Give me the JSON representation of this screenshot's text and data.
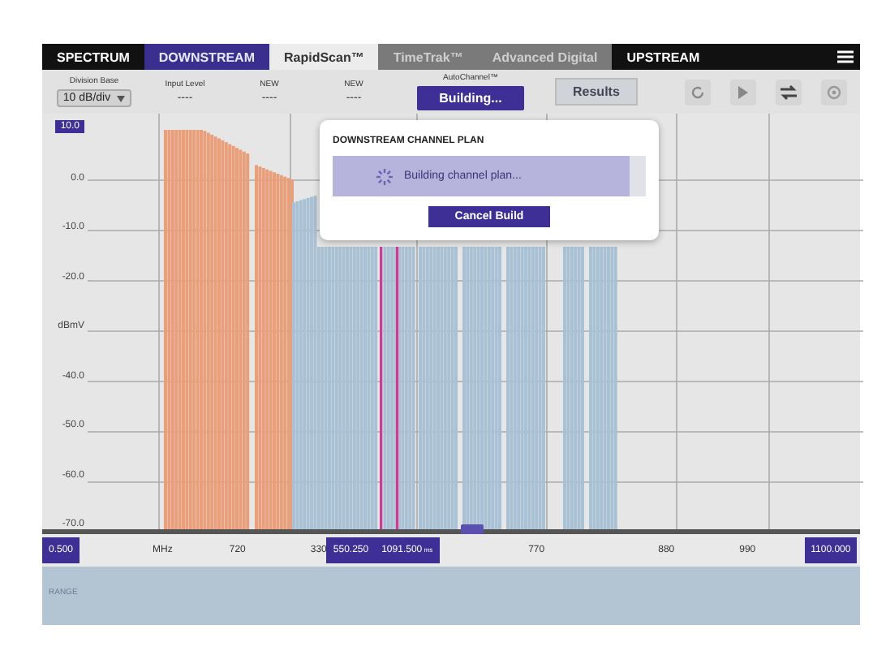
{
  "tabs": [
    {
      "label": "SPECTRUM",
      "kind": "mode",
      "selected": false
    },
    {
      "label": "DOWNSTREAM",
      "kind": "mode",
      "selected": true
    },
    {
      "label": "RapidScan™",
      "kind": "view",
      "selected": true
    },
    {
      "label": "TimeTrak™",
      "kind": "view",
      "selected": false
    },
    {
      "label": "Advanced Digital",
      "kind": "view",
      "selected": false
    },
    {
      "label": "UPSTREAM",
      "kind": "mode",
      "selected": false
    }
  ],
  "toolbar": {
    "fields": [
      {
        "label": "Division Base",
        "value": "10 dB/div",
        "kind": "select"
      },
      {
        "label": "Input Level",
        "value": "----",
        "kind": "text"
      },
      {
        "label": "NEW",
        "value": "----",
        "kind": "text"
      },
      {
        "label": "NEW",
        "value": "----",
        "kind": "text"
      }
    ],
    "autochannel": {
      "label": "AutoChannel™",
      "button": "Building..."
    },
    "results_button": "Results"
  },
  "chart": {
    "y_ticks": [
      "10.0",
      "0.0",
      "-10.0",
      "-20.0",
      "dBmV",
      "-40.0",
      "-50.0",
      "-60.0",
      "-70.0"
    ],
    "x_labels": [
      {
        "text": "0.500",
        "kind": "box"
      },
      {
        "text": "MHz",
        "kind": "plain"
      },
      {
        "text": "720",
        "kind": "plain"
      },
      {
        "text": "330",
        "kind": "plain"
      },
      {
        "text": "550.250",
        "kind": "box"
      },
      {
        "text": "1091.500",
        "unit": "ms",
        "kind": "box"
      },
      {
        "text": "770",
        "kind": "plain"
      },
      {
        "text": "880",
        "kind": "plain"
      },
      {
        "text": "990",
        "kind": "plain"
      },
      {
        "text": "1100.000",
        "kind": "box"
      }
    ],
    "range_label": "RANGE"
  },
  "dialog": {
    "title": "DOWNSTREAM CHANNEL PLAN",
    "status": "Building channel plan...",
    "level": 0.95,
    "cancel_button": "Cancel Build"
  }
}
